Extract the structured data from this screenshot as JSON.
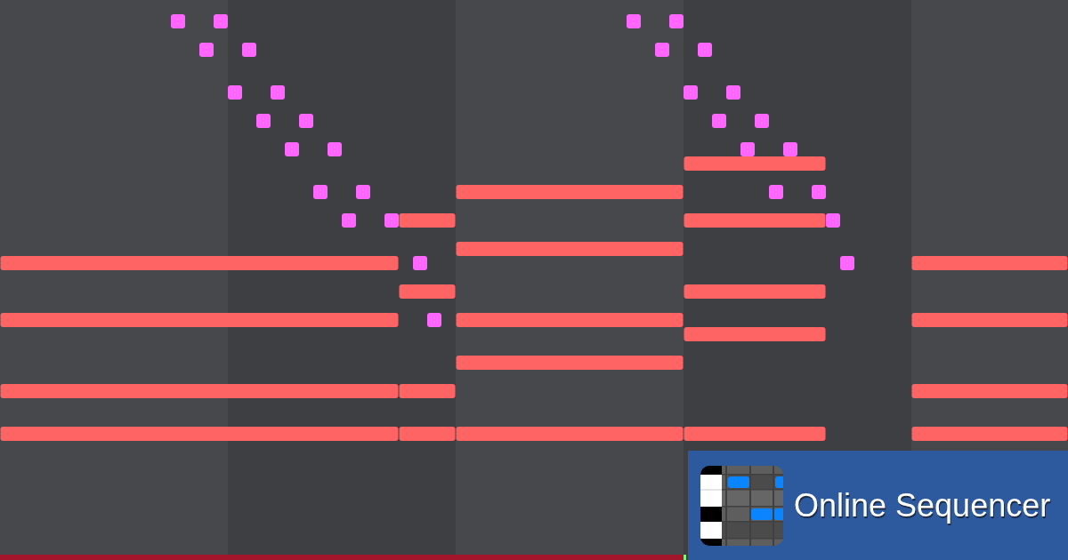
{
  "logo": {
    "text": "Online Sequencer"
  }
}
